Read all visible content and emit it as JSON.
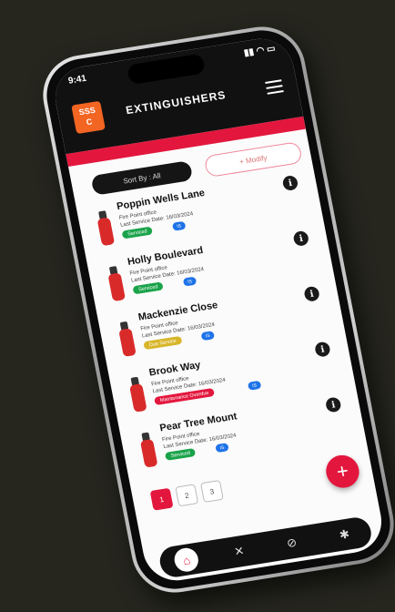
{
  "status_bar": {
    "time": "9:41",
    "indicators": "▮▮ ◠ ▭"
  },
  "app": {
    "logo_text_1": "SSS",
    "logo_text_2": "C",
    "title": "EXTINGUISHERS",
    "menu_icon": "hamburger-icon"
  },
  "controls": {
    "sort_label": "Sort By : All",
    "modify_label": "+ Modify"
  },
  "items": [
    {
      "name": "Poppin Wells Lane",
      "location": "Fire Point office",
      "service_date": "Last Service Date: 16/03/2024",
      "status": "Serviced",
      "status_color": "#1aa34a",
      "tag": "IS"
    },
    {
      "name": "Holly Boulevard",
      "location": "Fire Point office",
      "service_date": "Last Service Date: 16/03/2024",
      "status": "Serviced",
      "status_color": "#1aa34a",
      "tag": "IS"
    },
    {
      "name": "Mackenzie Close",
      "location": "Fire Point office",
      "service_date": "Last Service Date: 16/03/2024",
      "status": "Due Service",
      "status_color": "#d8b62a",
      "tag": "IS"
    },
    {
      "name": "Brook Way",
      "location": "Fire Point office",
      "service_date": "Last Service Date: 16/03/2024",
      "status": "Maintenance Overdue",
      "status_color": "#e3173e",
      "tag": "IS"
    },
    {
      "name": "Pear Tree Mount",
      "location": "Fire Point office",
      "service_date": "Last Service Date: 16/03/2024",
      "status": "Serviced",
      "status_color": "#1aa34a",
      "tag": "IS"
    }
  ],
  "pagination": {
    "pages": [
      "1",
      "2",
      "3"
    ],
    "active": 0
  },
  "fab": {
    "label": "+"
  },
  "bottom_nav": [
    {
      "icon": "home-icon",
      "glyph": "⌂"
    },
    {
      "icon": "tools-icon",
      "glyph": "✕"
    },
    {
      "icon": "compass-icon",
      "glyph": "⊘"
    },
    {
      "icon": "settings-icon",
      "glyph": "✱"
    }
  ],
  "colors": {
    "accent": "#e3173e",
    "brand_orange": "#f26522",
    "dark": "#111111"
  }
}
